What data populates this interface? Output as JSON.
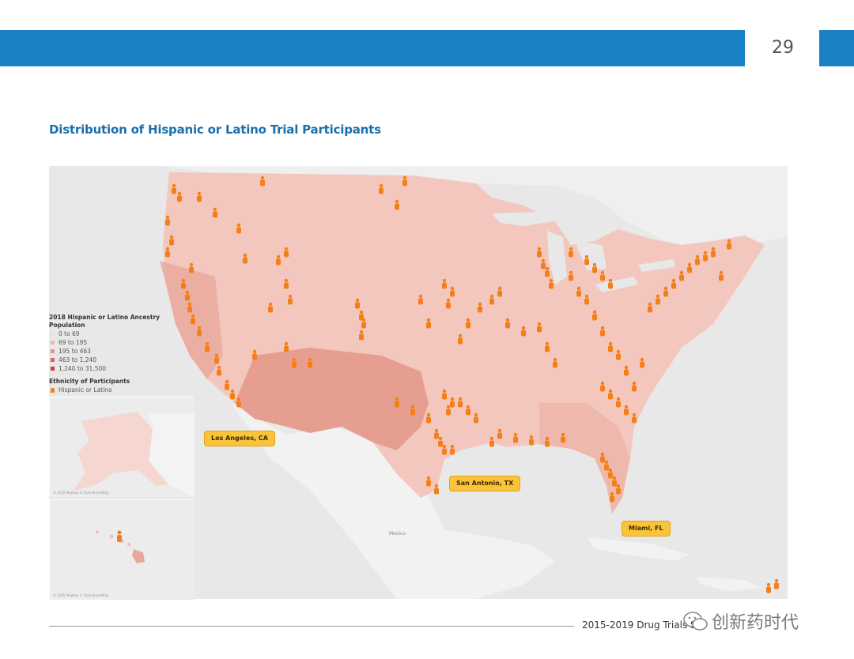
{
  "header": {
    "page_number": "29"
  },
  "title": "Distribution of Hispanic or Latino Trial Participants",
  "legend": {
    "population_title_line1": "2018 Hispanic or Latino Ancestry",
    "population_title_line2": "Population",
    "population_bins": [
      {
        "label": "0 to 69",
        "color": "#f7dcd6"
      },
      {
        "label": "69 to 195",
        "color": "#f2b8ad"
      },
      {
        "label": "195 to 463",
        "color": "#e99283"
      },
      {
        "label": "463 to 1,240",
        "color": "#d96a5b"
      },
      {
        "label": "1,240 to 31,500",
        "color": "#c8443a"
      }
    ],
    "participants_title": "Ethnicity of Participants",
    "participants_item": {
      "label": "Hispanic or Latino",
      "color": "#f57f17"
    }
  },
  "callouts": {
    "los_angeles": "Los Angeles, CA",
    "san_antonio": "San Antonio, TX",
    "miami": "Miami, FL"
  },
  "map_labels": {
    "mexico": "Mexico"
  },
  "footer": {
    "text": "2015-2019 Drug Trials Sn",
    "watermark": "创新药时代"
  },
  "colors": {
    "header_bar": "#1a82c4",
    "title": "#1a6fae",
    "participant_marker": "#f57f17",
    "callout_fill": "#f9c43a"
  }
}
